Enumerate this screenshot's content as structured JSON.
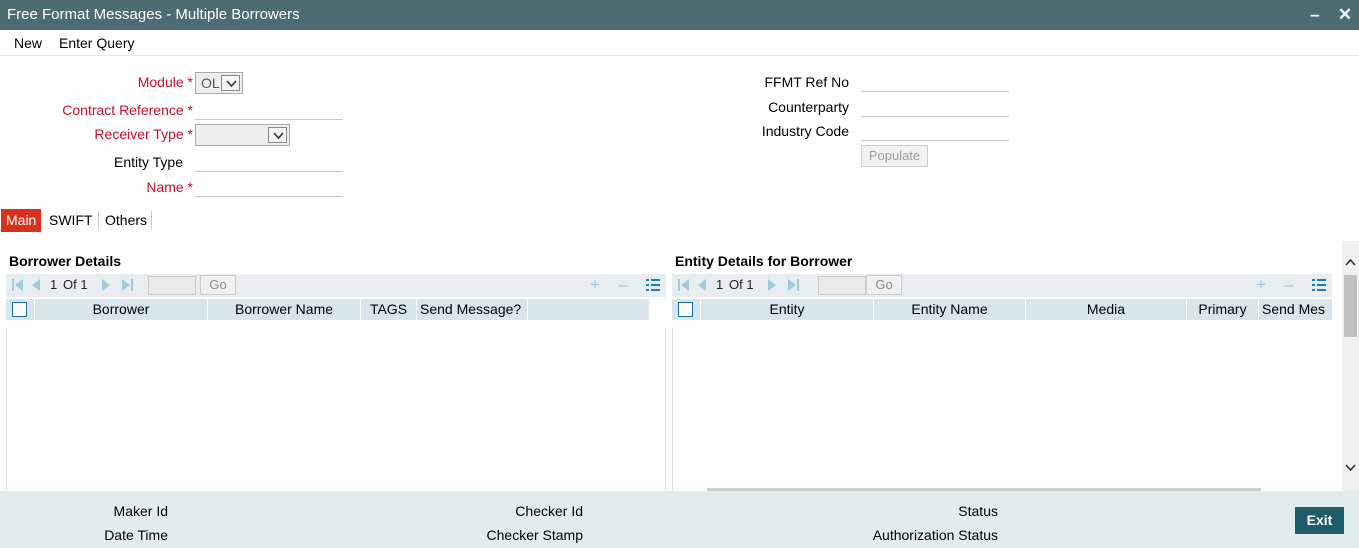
{
  "window": {
    "title": "Free Format Messages - Multiple Borrowers"
  },
  "menu": {
    "new": "New",
    "enter_query": "Enter Query"
  },
  "form": {
    "module_label": "Module *",
    "module_value": "OL",
    "contract_ref_label": "Contract Reference *",
    "receiver_type_label": "Receiver Type *",
    "entity_type_label": "Entity Type",
    "name_label": "Name *",
    "ffmt_ref_label": "FFMT Ref No",
    "counterparty_label": "Counterparty",
    "industry_code_label": "Industry Code",
    "populate_label": "Populate"
  },
  "tabs": [
    "Main",
    "SWIFT",
    "Others"
  ],
  "borrower": {
    "title": "Borrower Details",
    "page": "1",
    "of": "Of 1",
    "go": "Go",
    "columns": [
      "Borrower",
      "Borrower Name",
      "TAGS",
      "Send Message?"
    ]
  },
  "entity": {
    "title": "Entity Details for Borrower",
    "page": "1",
    "of": "Of 1",
    "go": "Go",
    "columns": [
      "Entity",
      "Entity Name",
      "Media",
      "Primary",
      "Send Mes"
    ]
  },
  "footer": {
    "maker_id": "Maker Id",
    "date_time": "Date Time",
    "checker_id": "Checker Id",
    "checker_stamp": "Checker Stamp",
    "status": "Status",
    "auth_status": "Authorization Status",
    "exit": "Exit"
  },
  "colors": {
    "titlebar": "#4d6b72",
    "active_tab": "#d9301d",
    "required": "#c8102e",
    "exit": "#1e5c6a"
  }
}
